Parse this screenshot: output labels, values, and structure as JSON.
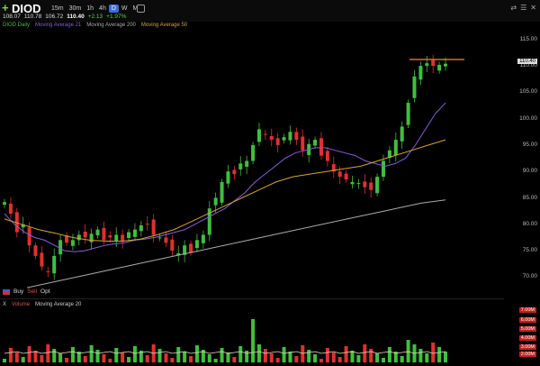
{
  "symbol": "DIOD",
  "timeframes": [
    {
      "label": "15m",
      "active": false
    },
    {
      "label": "30m",
      "active": false
    },
    {
      "label": "1h",
      "active": false
    },
    {
      "label": "4h",
      "active": false
    },
    {
      "label": "D",
      "active": true
    },
    {
      "label": "W",
      "active": false
    },
    {
      "label": "M",
      "active": false
    }
  ],
  "ohlc": {
    "open": "108.07",
    "high": "110.78",
    "low": "106.72",
    "close": "110.40",
    "change": "+2.13",
    "change_pct": "+1.97%"
  },
  "legend": [
    {
      "label": "DIOD Daily",
      "color": "#3fbf3f"
    },
    {
      "label": "Moving Average 21",
      "color": "#8a5cd8"
    },
    {
      "label": "Moving Average 200",
      "color": "#aaaaaa"
    },
    {
      "label": "Moving Average 50",
      "color": "#d4a43a"
    }
  ],
  "y_axis": [
    "115.00",
    "110.00",
    "105.00",
    "100.00",
    "95.00",
    "90.00",
    "85.00",
    "80.00",
    "75.00",
    "70.00"
  ],
  "price_tag": "110.40",
  "trade": {
    "buy": "Buy",
    "sell": "Sell",
    "opt": "Opt"
  },
  "volume_pane": {
    "prefix": "X",
    "name": "Volume",
    "ma": "Moving Average 20"
  },
  "volume_labels": [
    "7.00M",
    "6.00M",
    "5.00M",
    "4.00M",
    "3.00M",
    "2.00M",
    "1.00M"
  ],
  "chart_data": {
    "type": "candlestick",
    "series": [
      {
        "name": "DIOD Daily",
        "values": [
          84.2,
          82,
          78.5,
          80,
          76,
          74,
          72,
          71,
          74,
          77,
          76.5,
          77,
          78,
          77.5,
          78.2,
          79,
          77,
          77.5,
          78,
          76.8,
          78.5,
          79,
          79.8,
          80,
          78,
          77.5,
          76.5,
          75,
          74.5,
          76,
          74.6,
          77,
          78,
          83,
          85,
          88,
          90,
          89.5,
          91.5,
          92,
          95,
          98,
          97,
          96,
          95,
          96.5,
          97.5,
          96,
          94,
          95.2,
          96,
          93,
          92,
          90,
          89,
          88.5,
          88,
          87.8,
          87,
          86.5,
          89,
          92,
          94,
          96,
          98.5,
          103,
          108,
          110,
          110.5,
          110,
          110.2,
          110.4
        ]
      },
      {
        "name": "Moving Average 21",
        "values": [
          82,
          80,
          78.5,
          77.5,
          77,
          76,
          75,
          74.8,
          75,
          75.5,
          76,
          76.3,
          76.5,
          77,
          77.2,
          77.5,
          78,
          78.5,
          79,
          80,
          81,
          82,
          83,
          84.5,
          86,
          88,
          89.5,
          91,
          92.5,
          93.5,
          94,
          94.5,
          94.5,
          94,
          93.5,
          93,
          92,
          91.5,
          91,
          91.5,
          92.5,
          95,
          98,
          101,
          103
        ]
      },
      {
        "name": "Moving Average 50",
        "values": [
          81,
          80,
          79,
          78.3,
          77.5,
          77,
          76.8,
          76.8,
          77.2,
          78,
          79,
          80.5,
          82,
          83.5,
          85,
          86.5,
          88,
          89,
          89.5,
          90,
          90.5,
          91,
          92,
          93,
          94,
          95,
          96
        ]
      },
      {
        "name": "Moving Average 200",
        "values": [
          68,
          69,
          70,
          71,
          72,
          73,
          74,
          75,
          76,
          77,
          78,
          79,
          80,
          81,
          82,
          83,
          84,
          84.6
        ]
      }
    ],
    "ylim": [
      67.5,
      116.5
    ]
  }
}
